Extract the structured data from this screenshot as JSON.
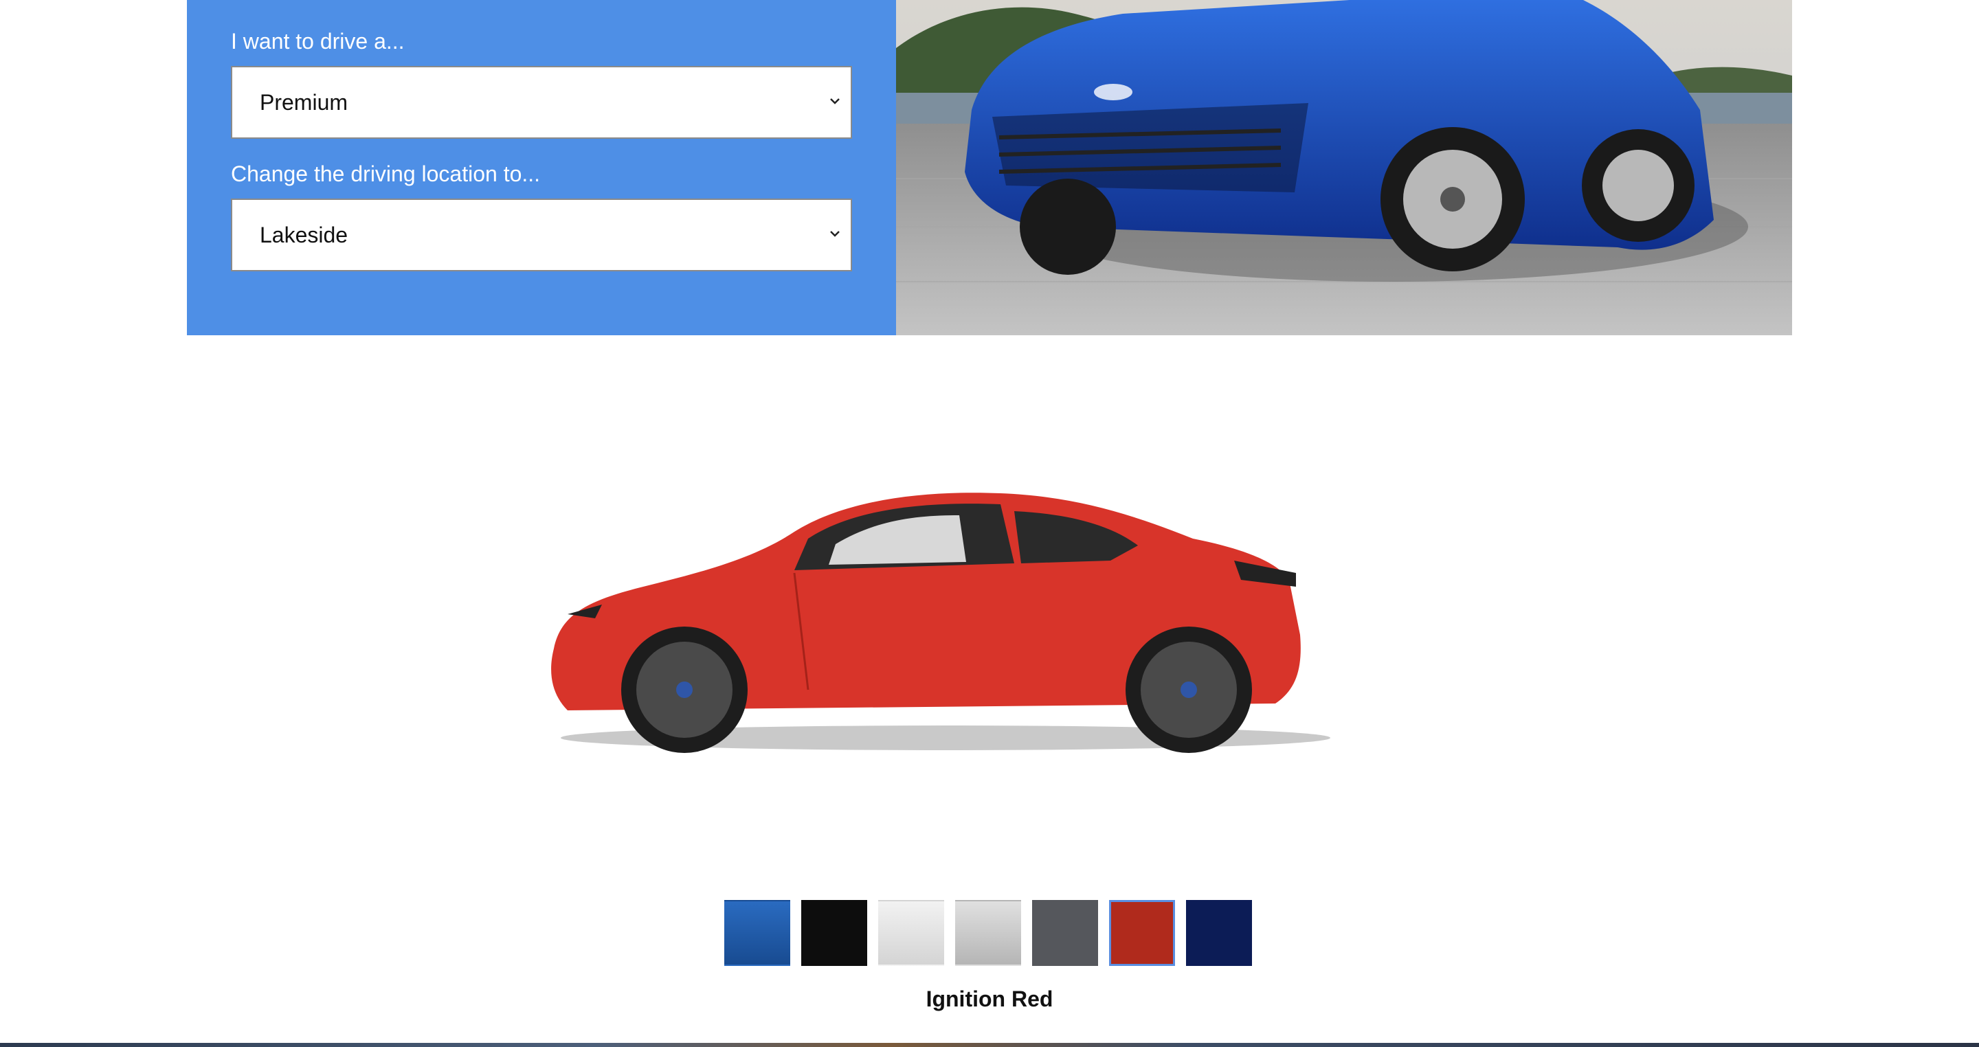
{
  "config": {
    "drive_label": "I want to drive a...",
    "drive_value": "Premium",
    "location_label": "Change the driving location to...",
    "location_value": "Lakeside"
  },
  "colors": {
    "panel_blue": "#4e8fe6",
    "swatches": [
      {
        "hex": "#1f5aa8",
        "selected": false
      },
      {
        "hex": "#0d0d0d",
        "selected": false
      },
      {
        "hex": "#e6e6e6",
        "selected": false
      },
      {
        "hex": "#cfcfcf",
        "selected": false
      },
      {
        "hex": "#55575c",
        "selected": false
      },
      {
        "hex": "#b02a1c",
        "selected": true
      },
      {
        "hex": "#0c1c56",
        "selected": false
      }
    ],
    "selected_name": "Ignition Red"
  },
  "icons": {
    "select_arrow": "chevron-down-icon"
  }
}
